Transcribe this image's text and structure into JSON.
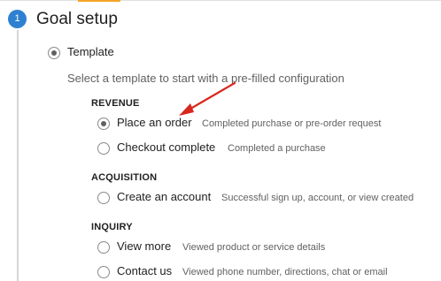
{
  "step": {
    "number": "1",
    "title": "Goal setup"
  },
  "template_option": {
    "label": "Template",
    "selected": true
  },
  "intro_text": "Select a template to start with a pre-filled configuration",
  "sections": [
    {
      "heading": "REVENUE",
      "options": [
        {
          "label": "Place an order",
          "description": "Completed purchase or pre-order request",
          "selected": true
        },
        {
          "label": "Checkout complete",
          "description": "Completed a purchase",
          "selected": false
        }
      ]
    },
    {
      "heading": "ACQUISITION",
      "options": [
        {
          "label": "Create an account",
          "description": "Successful sign up, account, or view created",
          "selected": false
        }
      ]
    },
    {
      "heading": "INQUIRY",
      "options": [
        {
          "label": "View more",
          "description": "Viewed product or service details",
          "selected": false
        },
        {
          "label": "Contact us",
          "description": "Viewed phone number, directions, chat or email",
          "selected": false
        }
      ]
    }
  ],
  "colors": {
    "step_badge": "#2f80d1",
    "top_tab_accent": "#f4a425",
    "annotation_arrow": "#d8281e"
  },
  "annotation": {
    "type": "arrow",
    "points_to": "Place an order"
  }
}
